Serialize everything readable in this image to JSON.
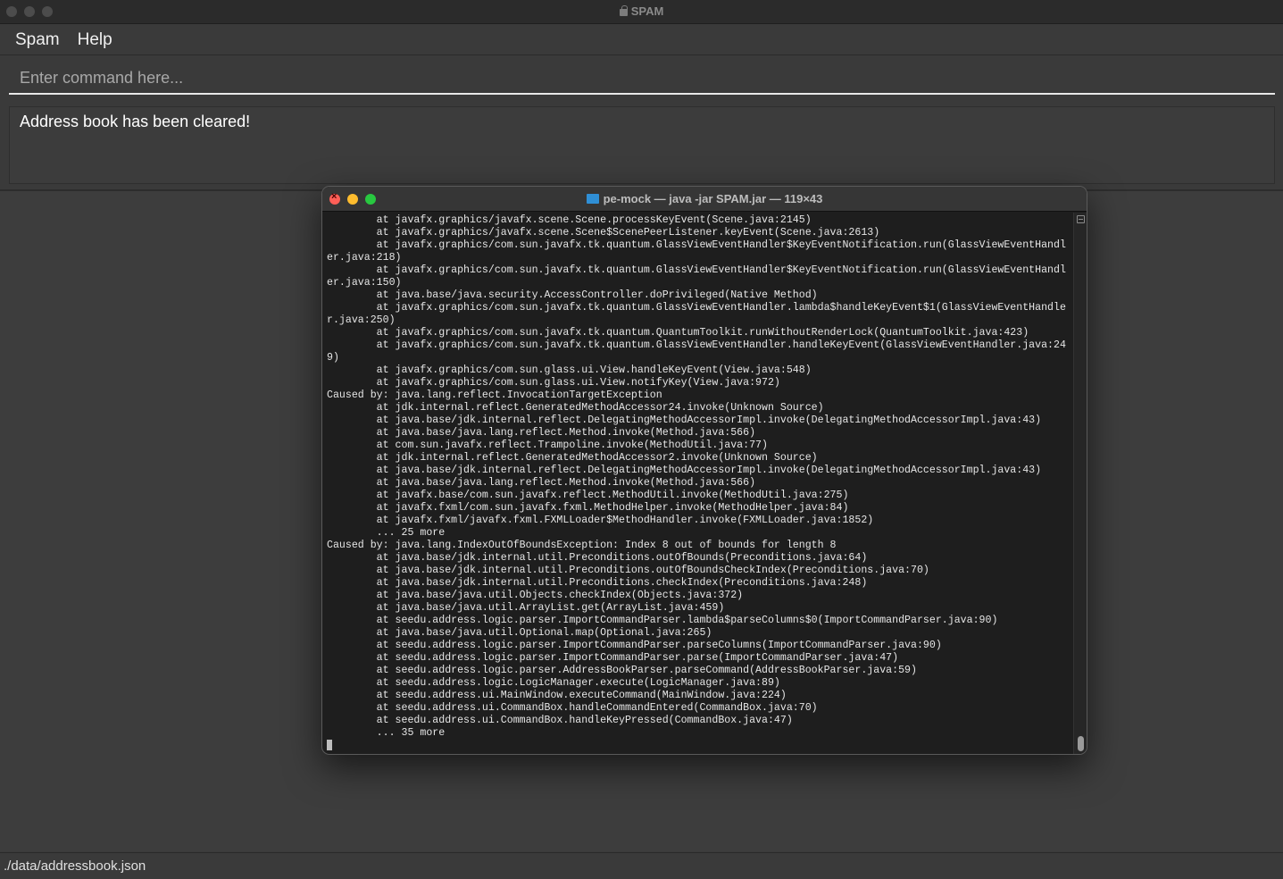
{
  "app": {
    "title": "SPAM",
    "menu": [
      {
        "label": "Spam"
      },
      {
        "label": "Help"
      }
    ],
    "command_box": {
      "placeholder": "Enter command here...",
      "value": ""
    },
    "result_display": "Address book has been cleared!",
    "status_bar": "./data/addressbook.json"
  },
  "terminal": {
    "title": "pe-mock — java -jar SPAM.jar — 119×43",
    "lines": [
      "        at javafx.graphics/javafx.scene.Scene.processKeyEvent(Scene.java:2145)",
      "        at javafx.graphics/javafx.scene.Scene$ScenePeerListener.keyEvent(Scene.java:2613)",
      "        at javafx.graphics/com.sun.javafx.tk.quantum.GlassViewEventHandler$KeyEventNotification.run(GlassViewEventHandl",
      "er.java:218)",
      "        at javafx.graphics/com.sun.javafx.tk.quantum.GlassViewEventHandler$KeyEventNotification.run(GlassViewEventHandl",
      "er.java:150)",
      "        at java.base/java.security.AccessController.doPrivileged(Native Method)",
      "        at javafx.graphics/com.sun.javafx.tk.quantum.GlassViewEventHandler.lambda$handleKeyEvent$1(GlassViewEventHandle",
      "r.java:250)",
      "        at javafx.graphics/com.sun.javafx.tk.quantum.QuantumToolkit.runWithoutRenderLock(QuantumToolkit.java:423)",
      "        at javafx.graphics/com.sun.javafx.tk.quantum.GlassViewEventHandler.handleKeyEvent(GlassViewEventHandler.java:24",
      "9)",
      "        at javafx.graphics/com.sun.glass.ui.View.handleKeyEvent(View.java:548)",
      "        at javafx.graphics/com.sun.glass.ui.View.notifyKey(View.java:972)",
      "Caused by: java.lang.reflect.InvocationTargetException",
      "        at jdk.internal.reflect.GeneratedMethodAccessor24.invoke(Unknown Source)",
      "        at java.base/jdk.internal.reflect.DelegatingMethodAccessorImpl.invoke(DelegatingMethodAccessorImpl.java:43)",
      "        at java.base/java.lang.reflect.Method.invoke(Method.java:566)",
      "        at com.sun.javafx.reflect.Trampoline.invoke(MethodUtil.java:77)",
      "        at jdk.internal.reflect.GeneratedMethodAccessor2.invoke(Unknown Source)",
      "        at java.base/jdk.internal.reflect.DelegatingMethodAccessorImpl.invoke(DelegatingMethodAccessorImpl.java:43)",
      "        at java.base/java.lang.reflect.Method.invoke(Method.java:566)",
      "        at javafx.base/com.sun.javafx.reflect.MethodUtil.invoke(MethodUtil.java:275)",
      "        at javafx.fxml/com.sun.javafx.fxml.MethodHelper.invoke(MethodHelper.java:84)",
      "        at javafx.fxml/javafx.fxml.FXMLLoader$MethodHandler.invoke(FXMLLoader.java:1852)",
      "        ... 25 more",
      "Caused by: java.lang.IndexOutOfBoundsException: Index 8 out of bounds for length 8",
      "        at java.base/jdk.internal.util.Preconditions.outOfBounds(Preconditions.java:64)",
      "        at java.base/jdk.internal.util.Preconditions.outOfBoundsCheckIndex(Preconditions.java:70)",
      "        at java.base/jdk.internal.util.Preconditions.checkIndex(Preconditions.java:248)",
      "        at java.base/java.util.Objects.checkIndex(Objects.java:372)",
      "        at java.base/java.util.ArrayList.get(ArrayList.java:459)",
      "        at seedu.address.logic.parser.ImportCommandParser.lambda$parseColumns$0(ImportCommandParser.java:90)",
      "        at java.base/java.util.Optional.map(Optional.java:265)",
      "        at seedu.address.logic.parser.ImportCommandParser.parseColumns(ImportCommandParser.java:90)",
      "        at seedu.address.logic.parser.ImportCommandParser.parse(ImportCommandParser.java:47)",
      "        at seedu.address.logic.parser.AddressBookParser.parseCommand(AddressBookParser.java:59)",
      "        at seedu.address.logic.LogicManager.execute(LogicManager.java:89)",
      "        at seedu.address.ui.MainWindow.executeCommand(MainWindow.java:224)",
      "        at seedu.address.ui.CommandBox.handleCommandEntered(CommandBox.java:70)",
      "        at seedu.address.ui.CommandBox.handleKeyPressed(CommandBox.java:47)",
      "        ... 35 more"
    ]
  }
}
